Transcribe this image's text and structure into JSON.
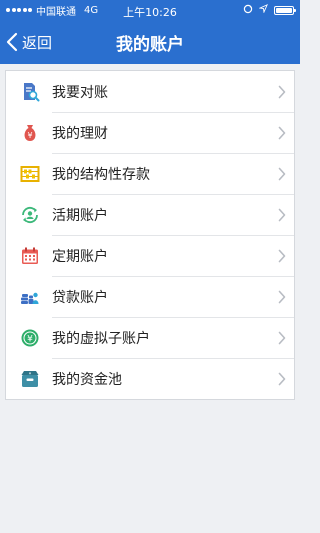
{
  "status_bar": {
    "carrier": "中国联通",
    "network": "4G",
    "time": "上午10:26"
  },
  "navbar": {
    "back_label": "返回",
    "title": "我的账户"
  },
  "menu": {
    "items": [
      {
        "label": "我要对账",
        "icon": "document-search-icon"
      },
      {
        "label": "我的理财",
        "icon": "money-bag-icon"
      },
      {
        "label": "我的结构性存款",
        "icon": "abacus-icon"
      },
      {
        "label": "活期账户",
        "icon": "user-refresh-icon"
      },
      {
        "label": "定期账户",
        "icon": "calendar-icon"
      },
      {
        "label": "贷款账户",
        "icon": "coins-user-icon"
      },
      {
        "label": "我的虚拟子账户",
        "icon": "yuan-coin-icon"
      },
      {
        "label": "我的资金池",
        "icon": "money-box-icon"
      }
    ]
  },
  "colors": {
    "header": "#2a6fcf",
    "background": "#eef0f3"
  }
}
